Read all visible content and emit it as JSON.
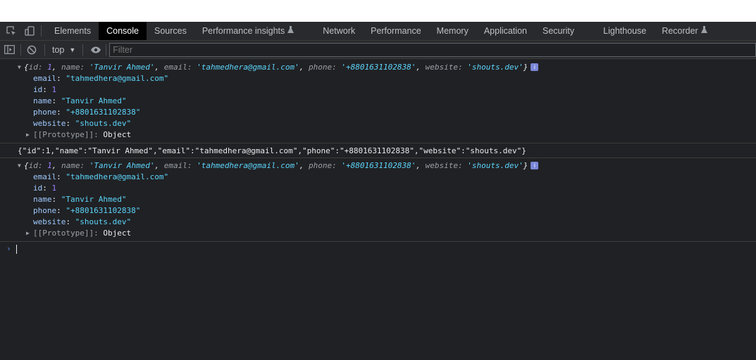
{
  "tabs": [
    {
      "label": "Elements"
    },
    {
      "label": "Console"
    },
    {
      "label": "Sources"
    },
    {
      "label": "Performance insights"
    },
    {
      "label": "Network"
    },
    {
      "label": "Performance"
    },
    {
      "label": "Memory"
    },
    {
      "label": "Application"
    },
    {
      "label": "Security"
    },
    {
      "label": "Lighthouse"
    },
    {
      "label": "Recorder"
    }
  ],
  "active_tab": "Console",
  "toolbar": {
    "context": "top",
    "filter_placeholder": "Filter"
  },
  "object": {
    "id": "1",
    "name": "'Tanvir Ahmed'",
    "email": "'tahmedhera@gmail.com'",
    "phone": "'+8801631102838'",
    "website": "'shouts.dev'",
    "email_value": "\"tahmedhera@gmail.com\"",
    "name_value": "\"Tanvir Ahmed\"",
    "phone_value": "\"+8801631102838\"",
    "website_value": "\"shouts.dev\"",
    "prototype_label": "[[Prototype]]",
    "prototype_value": "Object"
  },
  "json_line": "{\"id\":1,\"name\":\"Tanvir Ahmed\",\"email\":\"tahmedhera@gmail.com\",\"phone\":\"+8801631102838\",\"website\":\"shouts.dev\"}",
  "info_badge": "i",
  "colors": {
    "background": "#202124",
    "toolbar": "#292a2d",
    "string": "#5cd5fb",
    "number": "#9980ff",
    "key": "#9fc9ff",
    "prompt": "#4e8ee2"
  }
}
